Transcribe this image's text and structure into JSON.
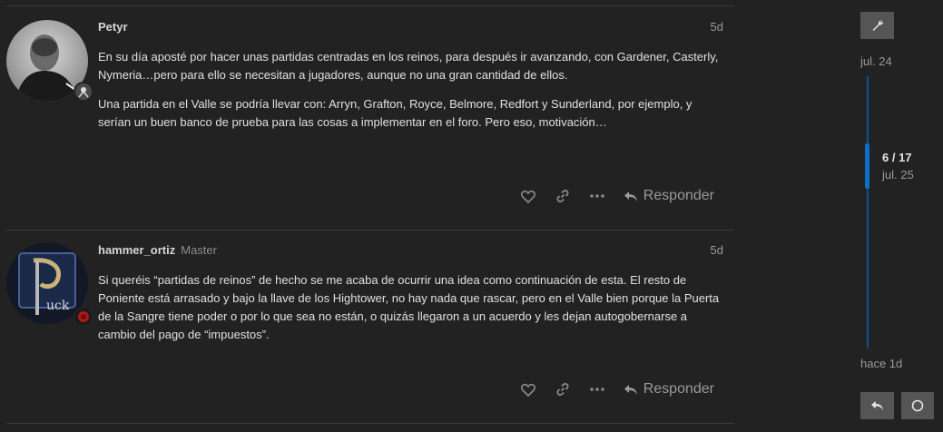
{
  "posts": [
    {
      "username": "Petyr",
      "user_title": "",
      "date": "5d",
      "paragraphs": [
        "En su día aposté por hacer unas partidas centradas en los reinos, para después ir avanzando, con Gardener, Casterly, Nymeria…pero para ello se necesitan a jugadores, aunque no una gran cantidad de ellos.",
        "Una partida en el Valle se podría llevar con: Arryn, Grafton, Royce, Belmore, Redfort y Sunderland, por ejemplo, y serían un buen banco de prueba para las cosas a implementar en el foro. Pero eso, motivación…"
      ],
      "reply_label": "Responder"
    },
    {
      "username": "hammer_ortiz",
      "user_title": "Master",
      "date": "5d",
      "paragraphs": [
        "Si queréis “partidas de reinos” de hecho se me acaba de ocurrir una idea como continuación de esta. El resto de Poniente está arrasado y bajo la llave de los Hightower, no hay nada que rascar, pero en el Valle bien porque la Puerta de la Sangre tiene poder o por lo que sea no están, o quizás llegaron a un acuerdo y les dejan autogobernarse a cambio del pago de “impuestos”."
      ],
      "reply_label": "Responder"
    }
  ],
  "timeline": {
    "start_date": "jul. 24",
    "position": "6 / 17",
    "current_date": "jul. 25",
    "end_date": "hace 1d"
  },
  "icons": {
    "like": "heart-icon",
    "link": "link-icon",
    "more": "ellipsis-icon",
    "reply": "reply-icon",
    "admin": "wrench-icon",
    "notifications": "circle-icon"
  },
  "colors": {
    "background": "#222222",
    "accent": "#0d70c7",
    "button": "#555555"
  }
}
